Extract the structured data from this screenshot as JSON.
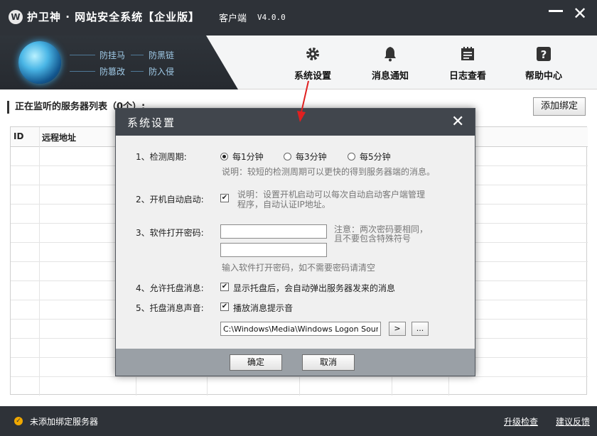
{
  "app": {
    "logo": "W",
    "title": "护卫神 · 网站安全系统【企业版】",
    "subtitle": "客户端",
    "version": "V4.0.0"
  },
  "features": [
    "防挂马",
    "防黑链",
    "防篡改",
    "防入侵"
  ],
  "nav": [
    {
      "label": "系统设置",
      "icon": "gear-icon"
    },
    {
      "label": "消息通知",
      "icon": "bell-icon"
    },
    {
      "label": "日志查看",
      "icon": "log-icon"
    },
    {
      "label": "帮助中心",
      "icon": "help-icon"
    }
  ],
  "main": {
    "section_title": "正在监听的服务器列表（0个）:",
    "add_button": "添加绑定",
    "columns": [
      "ID",
      "远程地址"
    ]
  },
  "status": {
    "text": "未添加绑定服务器",
    "upgrade_link": "升级检查",
    "feedback_link": "建议反馈"
  },
  "dialog": {
    "title": "系统设置",
    "close": "✕",
    "period": {
      "label": "1、检测周期:",
      "options": [
        "每1分钟",
        "每3分钟",
        "每5分钟"
      ],
      "selected": "每1分钟",
      "hint": "说明：较短的检测周期可以更快的得到服务器端的消息。"
    },
    "autostart": {
      "label": "2、开机自动启动:",
      "checked": true,
      "hint_line1": "说明：设置开机启动可以每次自动启动客户端管理",
      "hint_line2": "程序，自动认证IP地址。"
    },
    "password": {
      "label": "3、软件打开密码:",
      "value1": "",
      "value2": "",
      "note_line1": "注意：两次密码要相同，",
      "note_line2": "且不要包含特殊符号",
      "hint": "输入软件打开密码，如不需要密码请清空"
    },
    "tray": {
      "label": "4、允许托盘消息:",
      "checked": true,
      "text": "显示托盘后，会自动弹出服务器发来的消息"
    },
    "sound": {
      "label": "5、托盘消息声音:",
      "checked": true,
      "text": "播放消息提示音",
      "path": "C:\\Windows\\Media\\Windows Logon Sound.wav",
      "play_button": ">",
      "browse_button": "..."
    },
    "ok_button": "确定",
    "cancel_button": "取消"
  },
  "colors": {
    "titlebar": "#2e3238",
    "dialog_title": "#41464d",
    "dialog_footer": "#9aa0a6",
    "annotation_arrow": "#e02020"
  }
}
